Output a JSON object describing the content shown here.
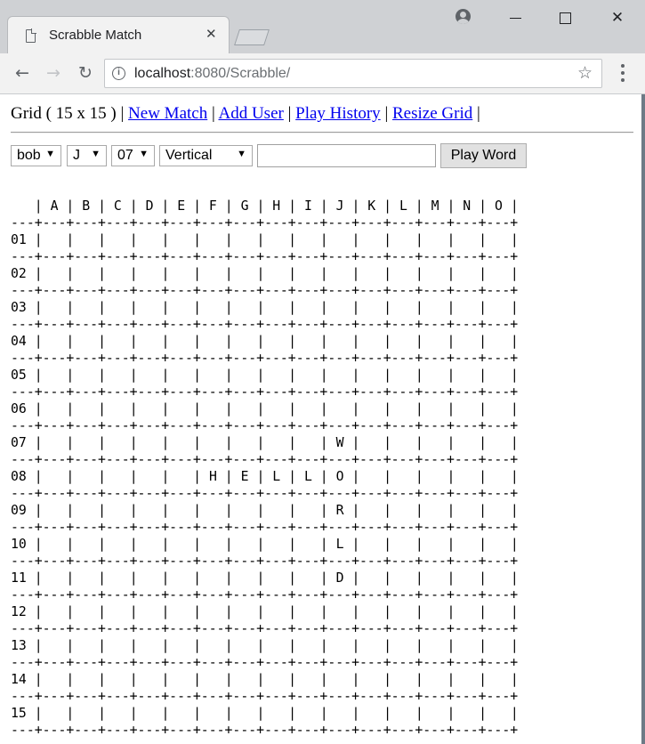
{
  "browser": {
    "tab_title": "Scrabble Match",
    "tab_close": "✕",
    "url_host": "localhost",
    "url_rest": ":8080/Scrabble/",
    "info_glyph": "i",
    "back_glyph": "←",
    "forward_glyph": "→",
    "reload_glyph": "↻",
    "star_glyph": "☆",
    "close_glyph": "✕"
  },
  "nav": {
    "grid_label": "Grid ( 15 x 15 )",
    "sep": "|",
    "links": [
      "New Match",
      "Add User",
      "Play History",
      "Resize Grid"
    ]
  },
  "controls": {
    "player": "bob",
    "column": "J",
    "row": "07",
    "direction": "Vertical",
    "word_value": "",
    "dropdown_arrow": "▼",
    "play_button": "Play Word"
  },
  "board": {
    "columns": [
      "A",
      "B",
      "C",
      "D",
      "E",
      "F",
      "G",
      "H",
      "I",
      "J",
      "K",
      "L",
      "M",
      "N",
      "O"
    ],
    "rows": [
      "01",
      "02",
      "03",
      "04",
      "05",
      "06",
      "07",
      "08",
      "09",
      "10",
      "11",
      "12",
      "13",
      "14",
      "15"
    ],
    "cells": [
      [
        "",
        "",
        "",
        "",
        "",
        "",
        "",
        "",
        "",
        "",
        "",
        "",
        "",
        "",
        ""
      ],
      [
        "",
        "",
        "",
        "",
        "",
        "",
        "",
        "",
        "",
        "",
        "",
        "",
        "",
        "",
        ""
      ],
      [
        "",
        "",
        "",
        "",
        "",
        "",
        "",
        "",
        "",
        "",
        "",
        "",
        "",
        "",
        ""
      ],
      [
        "",
        "",
        "",
        "",
        "",
        "",
        "",
        "",
        "",
        "",
        "",
        "",
        "",
        "",
        ""
      ],
      [
        "",
        "",
        "",
        "",
        "",
        "",
        "",
        "",
        "",
        "",
        "",
        "",
        "",
        "",
        ""
      ],
      [
        "",
        "",
        "",
        "",
        "",
        "",
        "",
        "",
        "",
        "",
        "",
        "",
        "",
        "",
        ""
      ],
      [
        "",
        "",
        "",
        "",
        "",
        "",
        "",
        "",
        "",
        "W",
        "",
        "",
        "",
        "",
        ""
      ],
      [
        "",
        "",
        "",
        "",
        "",
        "H",
        "E",
        "L",
        "L",
        "O",
        "",
        "",
        "",
        "",
        ""
      ],
      [
        "",
        "",
        "",
        "",
        "",
        "",
        "",
        "",
        "",
        "R",
        "",
        "",
        "",
        "",
        ""
      ],
      [
        "",
        "",
        "",
        "",
        "",
        "",
        "",
        "",
        "",
        "L",
        "",
        "",
        "",
        "",
        ""
      ],
      [
        "",
        "",
        "",
        "",
        "",
        "",
        "",
        "",
        "",
        "D",
        "",
        "",
        "",
        "",
        ""
      ],
      [
        "",
        "",
        "",
        "",
        "",
        "",
        "",
        "",
        "",
        "",
        "",
        "",
        "",
        "",
        ""
      ],
      [
        "",
        "",
        "",
        "",
        "",
        "",
        "",
        "",
        "",
        "",
        "",
        "",
        "",
        "",
        ""
      ],
      [
        "",
        "",
        "",
        "",
        "",
        "",
        "",
        "",
        "",
        "",
        "",
        "",
        "",
        "",
        ""
      ],
      [
        "",
        "",
        "",
        "",
        "",
        "",
        "",
        "",
        "",
        "",
        "",
        "",
        "",
        "",
        ""
      ]
    ]
  }
}
